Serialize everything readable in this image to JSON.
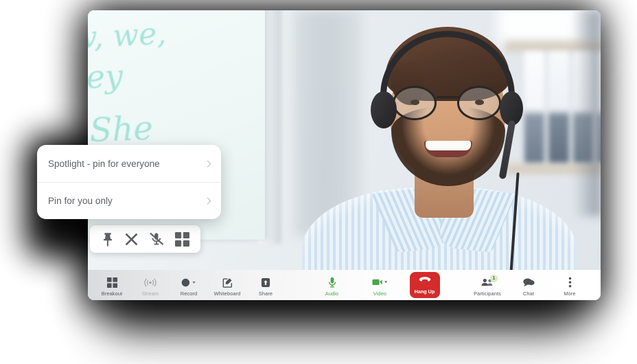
{
  "window": {
    "title": "video-call-window"
  },
  "video": {
    "whiteboard_lines": [
      "w, we,",
      "hey",
      ", She"
    ],
    "participant_description": "man-with-headset-smiling"
  },
  "context_menu": {
    "items": [
      {
        "label": "Spotlight - pin for everyone",
        "chevron": "chevron-right-icon"
      },
      {
        "label": "Pin for you only",
        "chevron": "chevron-right-icon"
      }
    ]
  },
  "icon_pill": {
    "items": [
      {
        "icon": "pin-icon",
        "name": "pin-participant"
      },
      {
        "icon": "close-icon",
        "name": "remove-participant"
      },
      {
        "icon": "mic-muted-icon",
        "name": "mute-participant"
      },
      {
        "icon": "grid-icon",
        "name": "change-layout"
      }
    ]
  },
  "toolbar": {
    "left": [
      {
        "label": "Breakout",
        "icon": "grid-icon",
        "dim": false,
        "caret": false
      },
      {
        "label": "Stream",
        "icon": "broadcast-icon",
        "dim": true,
        "caret": false
      },
      {
        "label": "Record",
        "icon": "record-circle-icon",
        "dim": false,
        "caret": true
      },
      {
        "label": "Whiteboard",
        "icon": "whiteboard-pencil-icon",
        "dim": false,
        "caret": false
      },
      {
        "label": "Share",
        "icon": "share-upload-icon",
        "dim": false,
        "caret": false
      }
    ],
    "center": [
      {
        "label": "Audio",
        "icon": "microphone-icon",
        "caret": false
      },
      {
        "label": "Video",
        "icon": "camera-icon",
        "caret": true
      }
    ],
    "hangup": {
      "label": "Hang Up",
      "icon": "phone-hangup-icon"
    },
    "right": [
      {
        "label": "Participants",
        "icon": "participants-icon",
        "badge": "1"
      },
      {
        "label": "Chat",
        "icon": "chat-bubble-icon",
        "badge": ""
      },
      {
        "label": "More",
        "icon": "more-vertical-icon",
        "badge": ""
      }
    ]
  },
  "colors": {
    "hangup_red": "#d42b2b",
    "accent_green": "#4aa64a",
    "badge_green": "#d6ecc2",
    "bar_text": "#55585c"
  }
}
